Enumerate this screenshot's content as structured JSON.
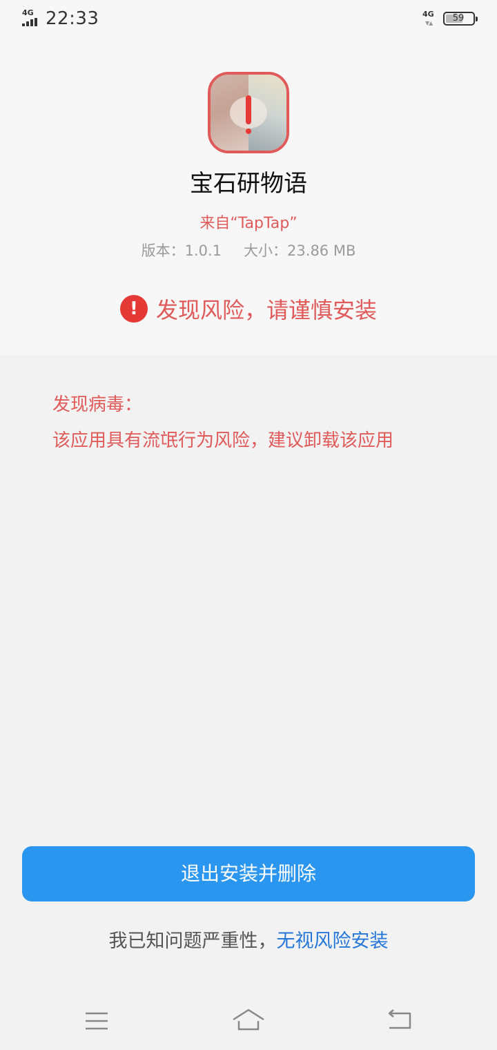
{
  "status_bar": {
    "network_left": "4G",
    "time": "22:33",
    "network_right": "4G",
    "battery": "59"
  },
  "app": {
    "name": "宝石研物语",
    "source": "来自“TapTap”",
    "version": "版本：1.0.1",
    "size": "大小：23.86 MB",
    "icon_name": "app-icon-warning"
  },
  "risk": {
    "icon": "!",
    "headline": "发现风险，请谨慎安装"
  },
  "virus": {
    "title": "发现病毒：",
    "description": "该应用具有流氓行为风险，建议卸载该应用"
  },
  "actions": {
    "primary_label": "退出安装并删除",
    "ignore_prefix": "我已知问题严重性，",
    "ignore_link": "无视风险安装"
  },
  "nav": {
    "menu_icon": "menu-icon",
    "home_icon": "home-icon",
    "back_icon": "back-icon"
  },
  "colors": {
    "warning_red": "#e05a5a",
    "primary_blue": "#2b96f0",
    "link_blue": "#2476d9"
  }
}
